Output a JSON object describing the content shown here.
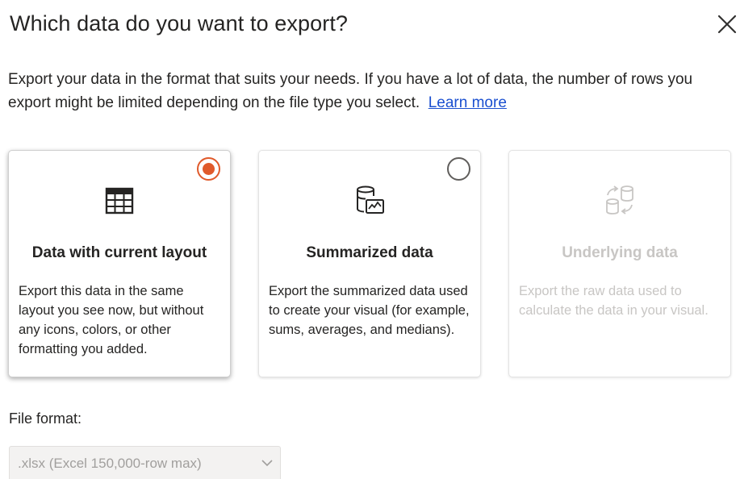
{
  "dialog": {
    "title": "Which data do you want to export?",
    "close_icon": "close-icon",
    "description": "Export your data in the format that suits your needs. If you have a lot of data, the number of rows you export might be limited depending on the file type you select.",
    "learn_more": "Learn more"
  },
  "options": [
    {
      "title": "Data with current layout",
      "description": "Export this data in the same layout you see now, but without any icons, colors, or other formatting you added.",
      "icon": "table-icon",
      "selected": true,
      "enabled": true
    },
    {
      "title": "Summarized data",
      "description": "Export the summarized data used to create your visual (for example, sums, averages, and medians).",
      "icon": "summarized-data-icon",
      "selected": false,
      "enabled": true
    },
    {
      "title": "Underlying data",
      "description": "Export the raw data used to calculate the data in your visual.",
      "icon": "underlying-data-icon",
      "selected": false,
      "enabled": false
    }
  ],
  "file_format": {
    "label": "File format:",
    "selected": ".xlsx (Excel 150,000-row max)"
  },
  "colors": {
    "accent": "#e05a2b",
    "link": "#1a4fd0",
    "disabled_text": "#c8c6c4"
  }
}
